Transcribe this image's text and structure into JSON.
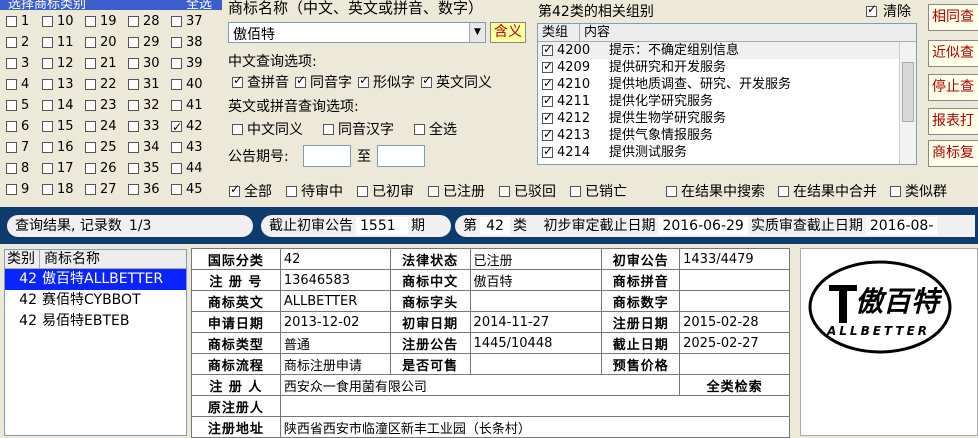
{
  "class_select": {
    "title": "选择商标类别",
    "all_label": "全选",
    "classes": [
      {
        "n": "1",
        "c": false
      },
      {
        "n": "10",
        "c": false
      },
      {
        "n": "19",
        "c": false
      },
      {
        "n": "28",
        "c": false
      },
      {
        "n": "37",
        "c": false
      },
      {
        "n": "2",
        "c": false
      },
      {
        "n": "11",
        "c": false
      },
      {
        "n": "20",
        "c": false
      },
      {
        "n": "29",
        "c": false
      },
      {
        "n": "38",
        "c": false
      },
      {
        "n": "3",
        "c": false
      },
      {
        "n": "12",
        "c": false
      },
      {
        "n": "21",
        "c": false
      },
      {
        "n": "30",
        "c": false
      },
      {
        "n": "39",
        "c": false
      },
      {
        "n": "4",
        "c": false
      },
      {
        "n": "13",
        "c": false
      },
      {
        "n": "22",
        "c": false
      },
      {
        "n": "31",
        "c": false
      },
      {
        "n": "40",
        "c": false
      },
      {
        "n": "5",
        "c": false
      },
      {
        "n": "14",
        "c": false
      },
      {
        "n": "23",
        "c": false
      },
      {
        "n": "32",
        "c": false
      },
      {
        "n": "41",
        "c": false
      },
      {
        "n": "6",
        "c": false
      },
      {
        "n": "15",
        "c": false
      },
      {
        "n": "24",
        "c": false
      },
      {
        "n": "33",
        "c": false
      },
      {
        "n": "42",
        "c": true
      },
      {
        "n": "7",
        "c": false
      },
      {
        "n": "16",
        "c": false
      },
      {
        "n": "25",
        "c": false
      },
      {
        "n": "34",
        "c": false
      },
      {
        "n": "43",
        "c": false
      },
      {
        "n": "8",
        "c": false
      },
      {
        "n": "17",
        "c": false
      },
      {
        "n": "26",
        "c": false
      },
      {
        "n": "35",
        "c": false
      },
      {
        "n": "44",
        "c": false
      },
      {
        "n": "9",
        "c": false
      },
      {
        "n": "18",
        "c": false
      },
      {
        "n": "27",
        "c": false
      },
      {
        "n": "36",
        "c": false
      },
      {
        "n": "45",
        "c": false
      }
    ]
  },
  "search": {
    "label": "商标名称（中文、英文或拼音、数字）",
    "value": "傲佰特",
    "contain_btn": "含义",
    "cn_opts_label": "中文查询选项:",
    "cn_opts": [
      {
        "t": "查拼音",
        "c": true
      },
      {
        "t": "同音字",
        "c": true
      },
      {
        "t": "形似字",
        "c": true
      },
      {
        "t": "英文同义",
        "c": true
      }
    ],
    "en_opts_label": "英文或拼音查询选项:",
    "en_opts": [
      {
        "t": "中文同义",
        "c": false
      },
      {
        "t": "同音汉字",
        "c": false
      },
      {
        "t": "全选",
        "c": false
      }
    ],
    "period_label": "公告期号:",
    "period_to": "至"
  },
  "groups": {
    "title": "第42类的相关组别",
    "clear_label": "清除",
    "col1": "类组",
    "col2": "内容",
    "rows": [
      {
        "code": "4200",
        "text": "提示：不确定组别信息"
      },
      {
        "code": "4209",
        "text": "提供研究和开发服务"
      },
      {
        "code": "4210",
        "text": "提供地质调查、研究、开发服务"
      },
      {
        "code": "4211",
        "text": "提供化学研究服务"
      },
      {
        "code": "4212",
        "text": "提供生物学研究服务"
      },
      {
        "code": "4213",
        "text": "提供气象情报服务"
      },
      {
        "code": "4214",
        "text": "提供测试服务"
      }
    ]
  },
  "right_buttons": [
    "相同查",
    "近似查",
    "停止查",
    "报表打",
    "商标复"
  ],
  "status_filters": [
    {
      "t": "全部",
      "c": true
    },
    {
      "t": "待审中",
      "c": false
    },
    {
      "t": "已初审",
      "c": false
    },
    {
      "t": "已注册",
      "c": false
    },
    {
      "t": "已驳回",
      "c": false
    },
    {
      "t": "已销亡",
      "c": false
    }
  ],
  "result_filters": [
    {
      "t": "在结果中搜索",
      "c": false
    },
    {
      "t": "在结果中合并",
      "c": false
    },
    {
      "t": "类似群",
      "c": false
    }
  ],
  "summary": {
    "result_label": "查询结果, 记录数",
    "result_value": "1/3",
    "cutoff_label": "截止初审公告",
    "cutoff_value": "1551",
    "cutoff_unit": "期",
    "class_pre": "第",
    "class_value": "42",
    "class_post": "类",
    "prelim_label": "初步审定截止日期",
    "prelim_value": "2016-06-29",
    "substantive_label": "实质审查截止日期",
    "substantive_value": "2016-08-"
  },
  "results": {
    "col_class": "类别",
    "col_name": "商标名称",
    "rows": [
      {
        "cls": "42",
        "name": "傲百特ALLBETTER",
        "sel": true
      },
      {
        "cls": "42",
        "name": "赛佰特CYBBOT",
        "sel": false
      },
      {
        "cls": "42",
        "name": "易佰特EBTEB",
        "sel": false
      }
    ]
  },
  "detail": {
    "intl_class_l": "国际分类",
    "intl_class": "42",
    "legal_status_l": "法律状态",
    "legal_status": "已注册",
    "prelim_ann_l": "初审公告",
    "prelim_ann": "1433/4479",
    "reg_no_l": "注 册 号",
    "reg_no": "13646583",
    "name_cn_l": "商标中文",
    "name_cn": "傲百特",
    "pinyin_l": "商标拼音",
    "pinyin": "",
    "name_en_l": "商标英文",
    "name_en": "ALLBETTER",
    "initials_l": "商标字头",
    "initials": "",
    "digits_l": "商标数字",
    "digits": "",
    "apply_date_l": "申请日期",
    "apply_date": "2013-12-02",
    "prelim_date_l": "初审日期",
    "prelim_date": "2014-11-27",
    "reg_date_l": "注册日期",
    "reg_date": "2015-02-28",
    "type_l": "商标类型",
    "type": "普通",
    "reg_ann_l": "注册公告",
    "reg_ann": "1445/10448",
    "expiry_l": "截止日期",
    "expiry": "2025-02-27",
    "flow_l": "商标流程",
    "flow": "商标注册申请",
    "shareable_l": "是否可售",
    "shareable": "",
    "presale_l": "预售价格",
    "presale": "",
    "registrant_l": "注 册 人",
    "registrant": "西安众一食用菌有限公司",
    "fullsearch": "全类检索",
    "orig_registrant_l": "原注册人",
    "orig_registrant": "",
    "reg_addr_l": "注册地址",
    "reg_addr": "陕西省西安市临潼区新丰工业园（长条村）"
  },
  "logo": {
    "cn_text": "傲百特",
    "en_text": "ALLBETTER"
  }
}
